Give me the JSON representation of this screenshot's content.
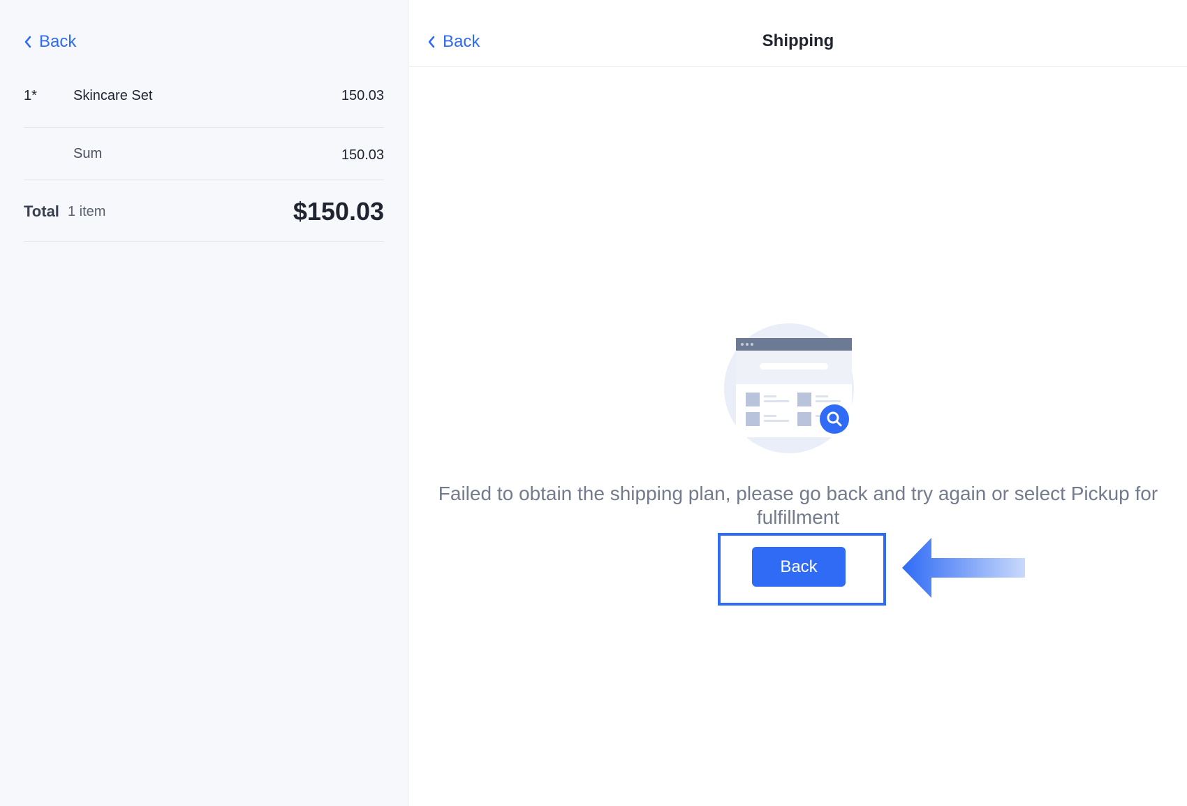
{
  "left_panel": {
    "back_label": "Back",
    "line_item": {
      "quantity": "1*",
      "name": "Skincare Set",
      "price": "150.03"
    },
    "sum": {
      "label": "Sum",
      "value": "150.03"
    },
    "total": {
      "label": "Total",
      "count": "1 item",
      "value": "$150.03"
    }
  },
  "right_panel": {
    "back_label": "Back",
    "title": "Shipping",
    "message": "Failed to obtain the shipping plan, please go back and try again or select Pickup for fulfillment",
    "primary_button_label": "Back"
  },
  "colors": {
    "accent": "#2f6bf5",
    "muted_text": "#737b8c",
    "panel_bg": "#f6f8fb"
  },
  "icons": [
    "chevron-left-icon",
    "search-icon",
    "arrow-left-icon"
  ]
}
